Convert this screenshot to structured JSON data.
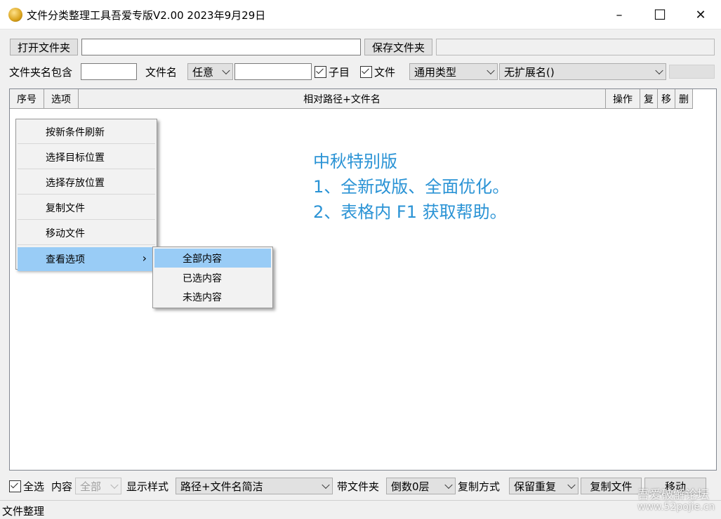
{
  "window": {
    "title": "文件分类整理工具吾爱专版V2.00  2023年9月29日",
    "minimize_glyph": "–",
    "maximize_glyph": "☐",
    "close_glyph": "✕"
  },
  "toolbar1": {
    "open_folder_label": "打开文件夹",
    "open_folder_path": "",
    "save_folder_label": "保存文件夹",
    "save_folder_path": ""
  },
  "toolbar2": {
    "folder_name_contains_label": "文件夹名包含",
    "folder_name_value": "",
    "filename_label": "文件名",
    "filename_mode": "任意",
    "filename_value": "",
    "subdir_label": "子目",
    "subdir_checked": true,
    "file_label": "文件",
    "file_checked": true,
    "type_select": "通用类型",
    "ext_select": "无扩展名()"
  },
  "grid": {
    "columns": [
      "序号",
      "选项",
      "相对路径+文件名",
      "操作",
      "复",
      "移",
      "删"
    ],
    "rows": []
  },
  "note": {
    "lines": [
      "中秋特别版",
      "1、全新改版、全面优化。",
      "2、表格内 F1  获取帮助。"
    ],
    "color": "#2a93d5"
  },
  "context_menu": {
    "items": [
      "按新条件刷新",
      "选择目标位置",
      "选择存放位置",
      "复制文件",
      "移动文件",
      "查看选项"
    ],
    "submenu_arrow": "›",
    "submenu": [
      "全部内容",
      "已选内容",
      "未选内容"
    ]
  },
  "bottombar": {
    "select_all_label": "全选",
    "select_all_checked": true,
    "content_label": "内容",
    "content_value": "全部",
    "display_style_label": "显示样式",
    "display_style_value": "路径+文件名简洁",
    "with_folder_label": "带文件夹",
    "with_folder_value": "倒数0层",
    "copy_mode_label": "复制方式",
    "copy_mode_value": "保留重复",
    "copy_files_button": "复制文件",
    "move_button": "移动"
  },
  "status": {
    "text": "文件整理"
  },
  "watermark": {
    "line1": "吾爱破解论坛",
    "line2": "www.52pojie.cn"
  }
}
